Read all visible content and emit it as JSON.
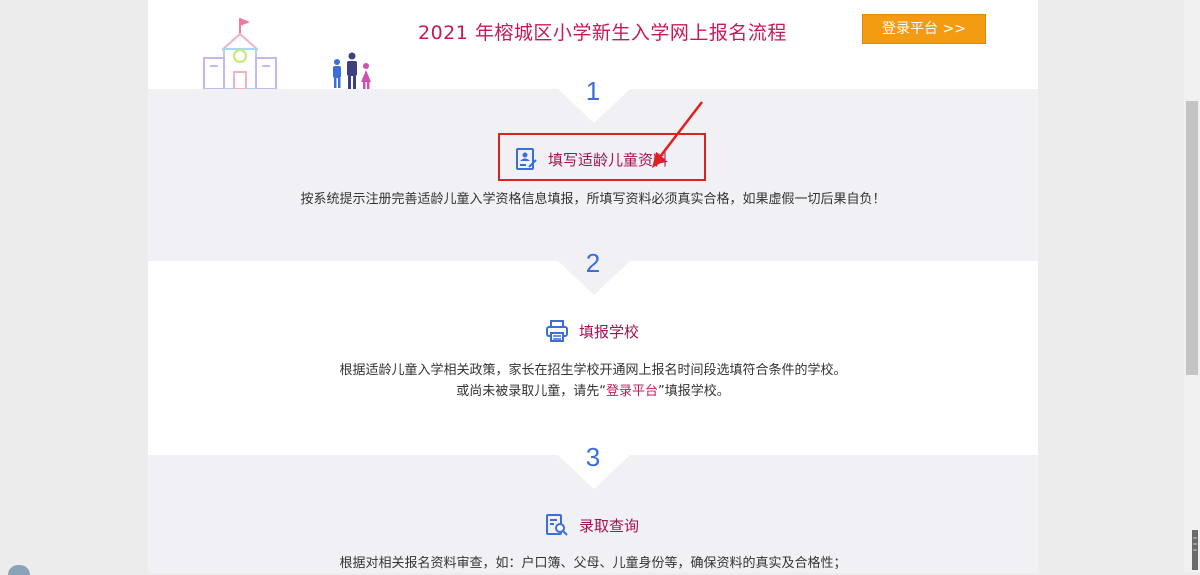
{
  "header": {
    "title": "2021 年榕城区小学新生入学网上报名流程",
    "login_button": "登录平台 >>"
  },
  "steps": [
    {
      "number": "1",
      "title": "填写适龄儿童资料",
      "icon": "user-form-icon",
      "desc_lines": [
        "按系统提示注册完善适龄儿童入学资格信息填报，所填写资料必须真实合格，如果虚假一切后果自负！"
      ]
    },
    {
      "number": "2",
      "title": "填报学校",
      "icon": "printer-icon",
      "desc_line1": "根据适龄儿童入学相关政策，家长在招生学校开通网上报名时间段选填符合条件的学校。",
      "desc_line2_pre": "或尚未被录取儿童，请先“",
      "desc_line2_link": "登录平台",
      "desc_line2_post": "”填报学校。"
    },
    {
      "number": "3",
      "title": "录取查询",
      "icon": "search-document-icon",
      "desc_lines": [
        "根据对相关报名资料审查，如：户口簿、父母、儿童身份等，确保资料的真实及合格性；"
      ]
    }
  ],
  "colors": {
    "title": "#c8185a",
    "step_number": "#3c6ed8",
    "button": "#f39c12",
    "highlight_box": "#e02020"
  }
}
